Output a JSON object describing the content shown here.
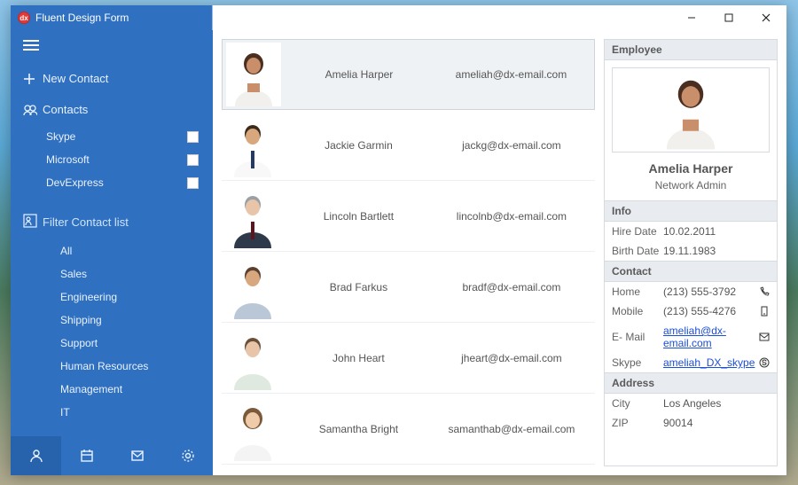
{
  "window": {
    "title": "Fluent Design Form"
  },
  "sidebar": {
    "new_contact": "New Contact",
    "contacts_label": "Contacts",
    "tags": [
      {
        "label": "Skype",
        "checked": false
      },
      {
        "label": "Microsoft",
        "checked": false
      },
      {
        "label": "DevExpress",
        "checked": false
      }
    ],
    "filter_label": "Filter Contact list",
    "filters": [
      "All",
      "Sales",
      "Engineering",
      "Shipping",
      "Support",
      "Human Resources",
      "Management",
      "IT"
    ]
  },
  "list": [
    {
      "name": "Amelia Harper",
      "email": "ameliah@dx-email.com",
      "selected": true,
      "avatar": "f1"
    },
    {
      "name": "Jackie Garmin",
      "email": "jackg@dx-email.com",
      "selected": false,
      "avatar": "m1"
    },
    {
      "name": "Lincoln Bartlett",
      "email": "lincolnb@dx-email.com",
      "selected": false,
      "avatar": "m2"
    },
    {
      "name": "Brad Farkus",
      "email": "bradf@dx-email.com",
      "selected": false,
      "avatar": "m3"
    },
    {
      "name": "John Heart",
      "email": "jheart@dx-email.com",
      "selected": false,
      "avatar": "m4"
    },
    {
      "name": "Samantha Bright",
      "email": "samanthab@dx-email.com",
      "selected": false,
      "avatar": "f2"
    }
  ],
  "detail": {
    "header_employee": "Employee",
    "name": "Amelia Harper",
    "role": "Network Admin",
    "header_info": "Info",
    "info": {
      "hire_label": "Hire Date",
      "hire": "10.02.2011",
      "birth_label": "Birth Date",
      "birth": "19.11.1983"
    },
    "header_contact": "Contact",
    "contact": {
      "home_label": "Home",
      "home": "(213) 555-3792",
      "mobile_label": "Mobile",
      "mobile": "(213) 555-4276",
      "email_label": "E- Mail",
      "email": "ameliah@dx-email.com",
      "skype_label": "Skype",
      "skype": "ameliah_DX_skype"
    },
    "header_address": "Address",
    "address": {
      "city_label": "City",
      "city": "Los Angeles",
      "zip_label": "ZIP",
      "zip": "90014"
    }
  }
}
